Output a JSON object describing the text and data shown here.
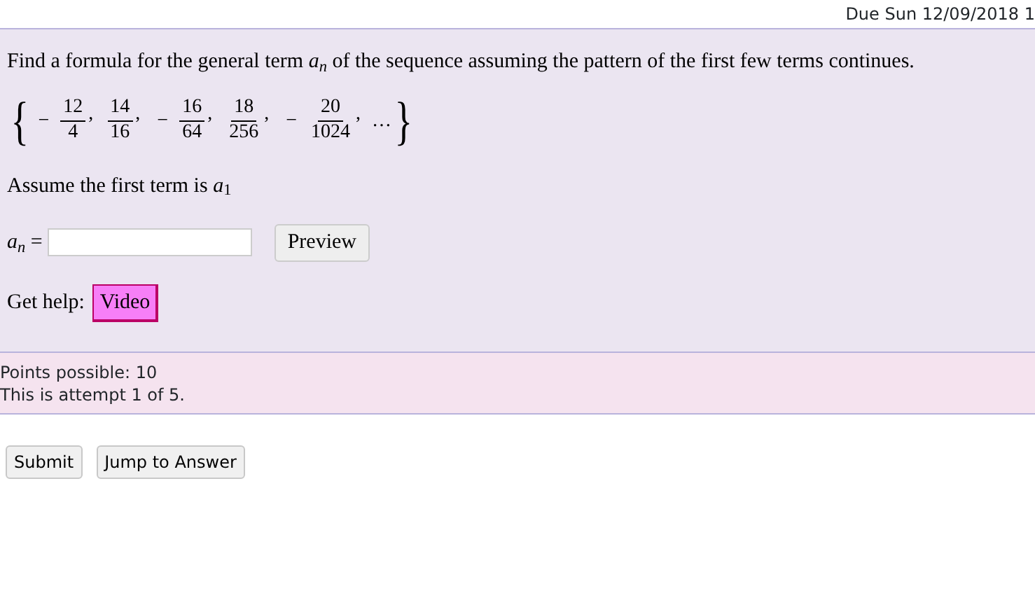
{
  "due": "Due Sun 12/09/2018 1",
  "question": {
    "prompt": "Find a formula for the general term *a*$_{n}$ of the sequence assuming the pattern of the first few terms continues.",
    "sequence": {
      "open": "{",
      "close": "}",
      "ellipsis": "…",
      "terms": [
        {
          "sign": "−",
          "numerator": "12",
          "denominator": "4",
          "separator": ","
        },
        {
          "numerator": "14",
          "denominator": "16",
          "separator": ","
        },
        {
          "sign": "−",
          "numerator": "16",
          "denominator": "64",
          "separator": ","
        },
        {
          "numerator": "18",
          "denominator": "256",
          "separator": ","
        },
        {
          "sign": "−",
          "numerator": "20",
          "denominator": "1024",
          "separator": ","
        }
      ]
    },
    "note": "Assume the first term is *a*$_{1}$",
    "answer": {
      "label": "*a*$_{n}$ =",
      "preview_button": "Preview"
    },
    "help": {
      "label": "Get help:",
      "button": "Video"
    }
  },
  "info": [
    "Points possible: 10",
    "This is attempt 1 of 5."
  ],
  "buttons": [
    "Submit",
    "Jump to Answer"
  ]
}
